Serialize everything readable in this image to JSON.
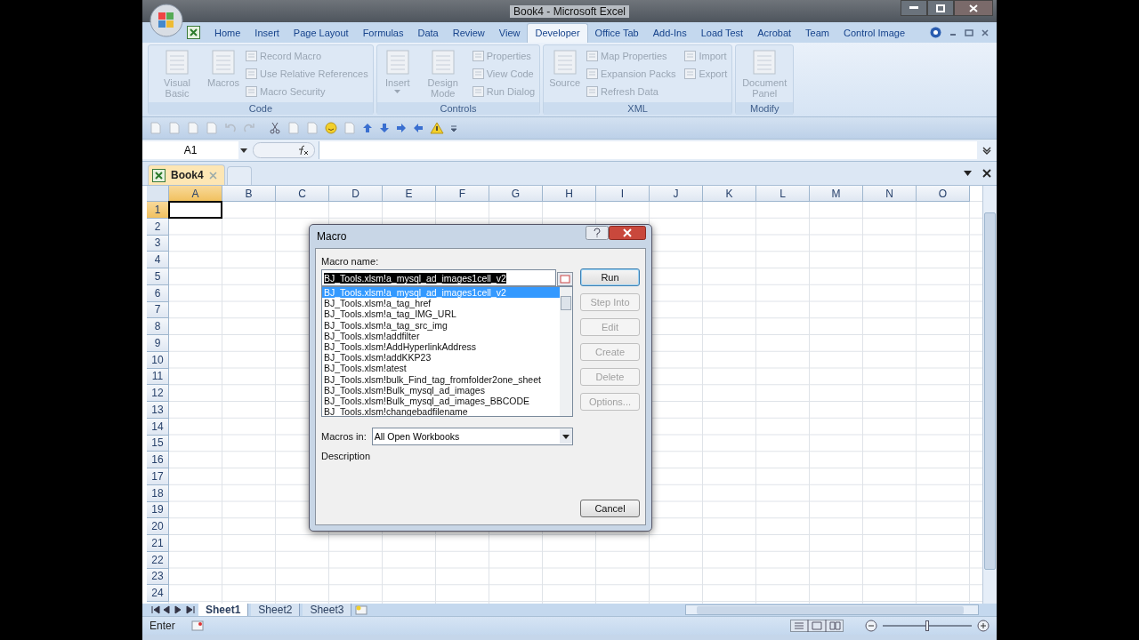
{
  "window": {
    "title": "Book4 - Microsoft Excel"
  },
  "ribbon_tabs": [
    {
      "label": "Home",
      "selected": false
    },
    {
      "label": "Insert",
      "selected": false
    },
    {
      "label": "Page Layout",
      "selected": false
    },
    {
      "label": "Formulas",
      "selected": false
    },
    {
      "label": "Data",
      "selected": false
    },
    {
      "label": "Review",
      "selected": false
    },
    {
      "label": "View",
      "selected": false
    },
    {
      "label": "Developer",
      "selected": true
    },
    {
      "label": "Office Tab",
      "selected": false
    },
    {
      "label": "Add-Ins",
      "selected": false
    },
    {
      "label": "Load Test",
      "selected": false
    },
    {
      "label": "Acrobat",
      "selected": false
    },
    {
      "label": "Team",
      "selected": false
    },
    {
      "label": "Control Image",
      "selected": false
    }
  ],
  "ribbon_groups": [
    {
      "title": "Code",
      "large": [
        {
          "label": "Visual Basic",
          "dropdown": false
        },
        {
          "label": "Macros",
          "dropdown": false
        }
      ],
      "small": [
        "Record Macro",
        "Use Relative References",
        "Macro Security"
      ]
    },
    {
      "title": "Controls",
      "large": [
        {
          "label": "Insert",
          "dropdown": true
        },
        {
          "label": "Design Mode",
          "dropdown": false
        }
      ],
      "small": [
        "Properties",
        "View Code",
        "Run Dialog"
      ]
    },
    {
      "title": "XML",
      "large": [
        {
          "label": "Source",
          "dropdown": false
        }
      ],
      "small": [
        "Map Properties",
        "Expansion Packs",
        "Refresh Data",
        "Import",
        "Export"
      ]
    },
    {
      "title": "Modify",
      "large": [
        {
          "label": "Document Panel",
          "dropdown": false
        }
      ]
    }
  ],
  "formula_bar": {
    "name_box": "A1"
  },
  "workbook_tabs": [
    {
      "label": "Book4",
      "selected": true
    }
  ],
  "grid": {
    "columns": [
      {
        "label": "A",
        "selected": true
      },
      {
        "label": "B",
        "selected": false
      },
      {
        "label": "C",
        "selected": false
      },
      {
        "label": "D",
        "selected": false
      },
      {
        "label": "E",
        "selected": false
      },
      {
        "label": "F",
        "selected": false
      },
      {
        "label": "G",
        "selected": false
      },
      {
        "label": "H",
        "selected": false
      },
      {
        "label": "I",
        "selected": false
      },
      {
        "label": "J",
        "selected": false
      },
      {
        "label": "K",
        "selected": false
      },
      {
        "label": "L",
        "selected": false
      },
      {
        "label": "M",
        "selected": false
      },
      {
        "label": "N",
        "selected": false
      },
      {
        "label": "O",
        "selected": false
      }
    ],
    "rows": [
      {
        "label": "1",
        "selected": true
      },
      {
        "label": "2",
        "selected": false
      },
      {
        "label": "3",
        "selected": false
      },
      {
        "label": "4",
        "selected": false
      },
      {
        "label": "5",
        "selected": false
      },
      {
        "label": "6",
        "selected": false
      },
      {
        "label": "7",
        "selected": false
      },
      {
        "label": "8",
        "selected": false
      },
      {
        "label": "9",
        "selected": false
      },
      {
        "label": "10",
        "selected": false
      },
      {
        "label": "11",
        "selected": false
      },
      {
        "label": "12",
        "selected": false
      },
      {
        "label": "13",
        "selected": false
      },
      {
        "label": "14",
        "selected": false
      },
      {
        "label": "15",
        "selected": false
      },
      {
        "label": "16",
        "selected": false
      },
      {
        "label": "17",
        "selected": false
      },
      {
        "label": "18",
        "selected": false
      },
      {
        "label": "19",
        "selected": false
      },
      {
        "label": "20",
        "selected": false
      },
      {
        "label": "21",
        "selected": false
      },
      {
        "label": "22",
        "selected": false
      },
      {
        "label": "23",
        "selected": false
      },
      {
        "label": "24",
        "selected": false
      }
    ]
  },
  "sheet_tabs": [
    {
      "label": "Sheet1",
      "selected": true
    },
    {
      "label": "Sheet2",
      "selected": false
    },
    {
      "label": "Sheet3",
      "selected": false
    }
  ],
  "status_bar": {
    "mode": "Enter",
    "zoom": {
      "level": 0.5
    }
  },
  "dialog": {
    "title": "Macro",
    "macro_name_label": "Macro name:",
    "macro_name": "BJ_Tools.xlsm!a_mysql_ad_images1cell_v2",
    "macros": [
      {
        "name": "BJ_Tools.xlsm!a_mysql_ad_images1cell_v2",
        "selected": true
      },
      {
        "name": "BJ_Tools.xlsm!a_tag_href",
        "selected": false
      },
      {
        "name": "BJ_Tools.xlsm!a_tag_IMG_URL",
        "selected": false
      },
      {
        "name": "BJ_Tools.xlsm!a_tag_src_img",
        "selected": false
      },
      {
        "name": "BJ_Tools.xlsm!addfilter",
        "selected": false
      },
      {
        "name": "BJ_Tools.xlsm!AddHyperlinkAddress",
        "selected": false
      },
      {
        "name": "BJ_Tools.xlsm!addKKP23",
        "selected": false
      },
      {
        "name": "BJ_Tools.xlsm!atest",
        "selected": false
      },
      {
        "name": "BJ_Tools.xlsm!bulk_Find_tag_fromfolder2one_sheet",
        "selected": false
      },
      {
        "name": "BJ_Tools.xlsm!Bulk_mysql_ad_images",
        "selected": false
      },
      {
        "name": "BJ_Tools.xlsm!Bulk_mysql_ad_images_BBCODE",
        "selected": false
      },
      {
        "name": "BJ_Tools.xlsm!changebadfilename",
        "selected": false
      }
    ],
    "buttons": [
      {
        "label": "Run",
        "disabled": false
      },
      {
        "label": "Step Into",
        "disabled": true
      },
      {
        "label": "Edit",
        "disabled": true
      },
      {
        "label": "Create",
        "disabled": true
      },
      {
        "label": "Delete",
        "disabled": true
      },
      {
        "label": "Options...",
        "disabled": true
      }
    ],
    "macros_in_label": "Macros in:",
    "macros_in": "All Open Workbooks",
    "description_label": "Description",
    "cancel": "Cancel"
  }
}
